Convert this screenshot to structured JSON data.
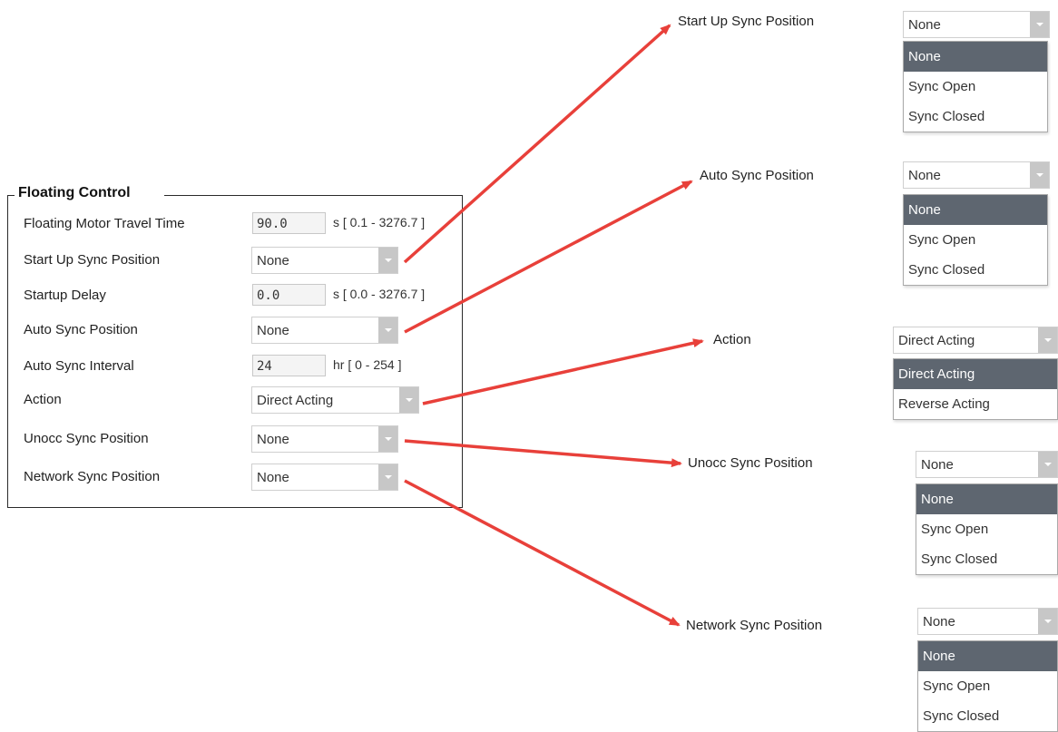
{
  "group": {
    "title": "Floating Control",
    "rows": [
      {
        "label": "Floating Motor Travel Time",
        "type": "text",
        "value": "90.0",
        "unit": "s [ 0.1 - 3276.7 ]"
      },
      {
        "label": "Start Up Sync Position",
        "type": "select",
        "value": "None"
      },
      {
        "label": "Startup Delay",
        "type": "text",
        "value": "0.0",
        "unit": "s [ 0.0 - 3276.7 ]"
      },
      {
        "label": "Auto Sync Position",
        "type": "select",
        "value": "None"
      },
      {
        "label": "Auto Sync Interval",
        "type": "text",
        "value": "24",
        "unit": "hr [ 0 - 254 ]"
      },
      {
        "label": "Action",
        "type": "select",
        "value": "Direct Acting"
      },
      {
        "label": "Unocc Sync Position",
        "type": "select",
        "value": "None"
      },
      {
        "label": "Network Sync Position",
        "type": "select",
        "value": "None"
      }
    ]
  },
  "callouts": [
    {
      "label": "Start Up Sync Position",
      "value": "None",
      "options": [
        "None",
        "Sync Open",
        "Sync Closed"
      ],
      "selected": 0
    },
    {
      "label": "Auto Sync Position",
      "value": "None",
      "options": [
        "None",
        "Sync Open",
        "Sync Closed"
      ],
      "selected": 0
    },
    {
      "label": "Action",
      "value": "Direct Acting",
      "options": [
        "Direct Acting",
        "Reverse Acting"
      ],
      "selected": 0
    },
    {
      "label": "Unocc Sync Position",
      "value": "None",
      "options": [
        "None",
        "Sync Open",
        "Sync Closed"
      ],
      "selected": 0
    },
    {
      "label": "Network Sync Position",
      "value": "None",
      "options": [
        "None",
        "Sync Open",
        "Sync Closed"
      ],
      "selected": 0
    }
  ],
  "colors": {
    "arrow": "#e8403a",
    "selected_option": "#5e6670",
    "dropdown_button": "#c7c7c7"
  },
  "icons": {
    "dropdown": "chevron-down-icon",
    "arrow": "red-arrow"
  }
}
